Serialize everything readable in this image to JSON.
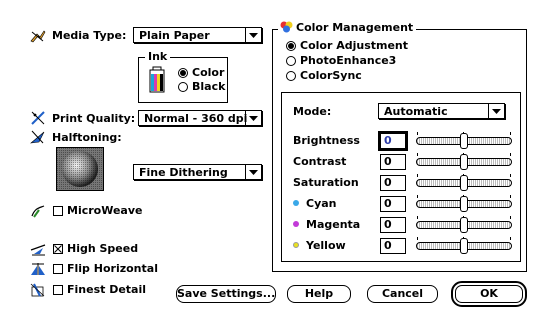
{
  "media_type": {
    "label": "Media Type:",
    "value": "Plain Paper"
  },
  "ink": {
    "label": "Ink",
    "options": [
      {
        "label": "Color",
        "selected": true
      },
      {
        "label": "Black",
        "selected": false
      }
    ]
  },
  "print_quality": {
    "label": "Print Quality:",
    "value": "Normal - 360 dpi"
  },
  "halftoning": {
    "label": "Halftoning:",
    "value": "Fine Dithering"
  },
  "checkboxes": [
    {
      "label": "MicroWeave",
      "checked": false
    },
    {
      "label": "High Speed",
      "checked": true
    },
    {
      "label": "Flip Horizontal",
      "checked": false
    },
    {
      "label": "Finest Detail",
      "checked": false
    }
  ],
  "color_management": {
    "label": "Color Management",
    "options": [
      {
        "label": "Color Adjustment",
        "selected": true
      },
      {
        "label": "PhotoEnhance3",
        "selected": false
      },
      {
        "label": "ColorSync",
        "selected": false
      }
    ]
  },
  "adjust": {
    "mode_label": "Mode:",
    "mode_value": "Automatic",
    "sliders": [
      {
        "label": "Brightness",
        "value": "0",
        "dot": null
      },
      {
        "label": "Contrast",
        "value": "0",
        "dot": null
      },
      {
        "label": "Saturation",
        "value": "0",
        "dot": null
      },
      {
        "label": "Cyan",
        "value": "0",
        "dot": "#3aa8e8"
      },
      {
        "label": "Magenta",
        "value": "0",
        "dot": "#c23ad8"
      },
      {
        "label": "Yellow",
        "value": "0",
        "dot": "#e8e020"
      }
    ]
  },
  "buttons": {
    "save_settings": "Save Settings...",
    "help": "Help",
    "cancel": "Cancel",
    "ok": "OK"
  }
}
